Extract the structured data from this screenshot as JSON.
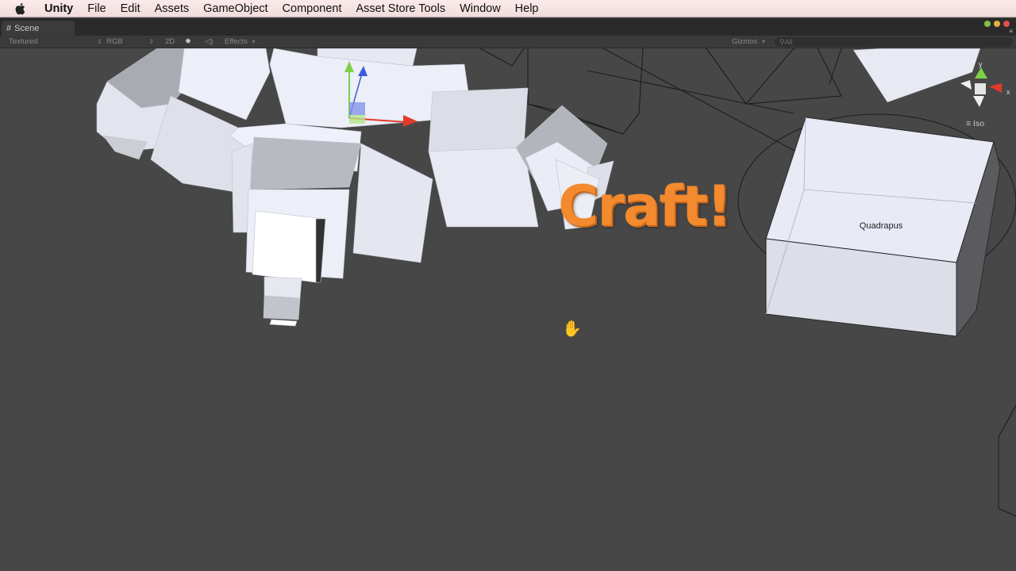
{
  "menubar": {
    "app": "Unity",
    "items": [
      "File",
      "Edit",
      "Assets",
      "GameObject",
      "Component",
      "Asset Store Tools",
      "Window",
      "Help"
    ]
  },
  "tab": {
    "label": "Scene"
  },
  "toolbar": {
    "shading": "Textured",
    "render_mode": "RGB",
    "mode_2d": "2D",
    "effects": "Effects",
    "gizmos": "Gizmos",
    "search_placeholder": "All"
  },
  "viewport": {
    "overlay_title": "Craft!",
    "object_label": "Quadrapus",
    "projection": "Iso",
    "gizmo_axes": {
      "y": "y",
      "x": "x"
    }
  },
  "colors": {
    "overlay_title": "#f38a2e",
    "background": "#474747",
    "axis_x": "#e03a2a",
    "axis_y": "#7ed04b",
    "axis_z": "#3b5bd9"
  },
  "icons": [
    "apple-icon",
    "scene-tab-icon",
    "sun-icon",
    "audio-icon",
    "search-icon",
    "hand-cursor-icon"
  ]
}
